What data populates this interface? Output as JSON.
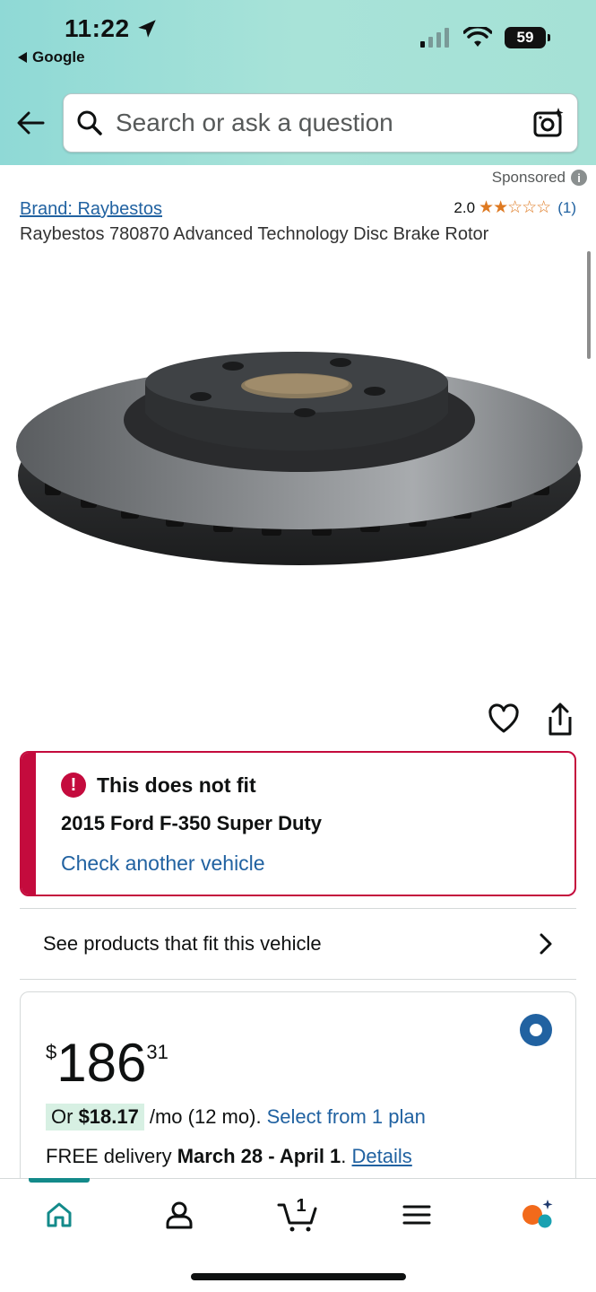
{
  "status": {
    "time": "11:22",
    "back_app": "Google",
    "battery": "59"
  },
  "search": {
    "placeholder": "Search or ask a question"
  },
  "product": {
    "sponsored": "Sponsored",
    "brand": "Brand: Raybestos",
    "rating_value": "2.0",
    "rating_stars": 2,
    "rating_count": "(1)",
    "title": "Raybestos 780870 Advanced Technology Disc Brake Rotor"
  },
  "fit": {
    "heading": "This does not fit",
    "vehicle": "2015 Ford F-350 Super Duty",
    "check_link": "Check another vehicle",
    "see_products": "See products that fit this vehicle"
  },
  "price": {
    "symbol": "$",
    "whole": "186",
    "fraction": "31",
    "monthly_prefix": "Or ",
    "monthly_amount": "$18.17",
    "monthly_suffix": "/mo (12 mo).",
    "plan_link": "Select from 1 plan",
    "delivery_prefix": "FREE delivery ",
    "delivery_dates": "March 28 - April 1",
    "delivery_suffix": ". ",
    "details_link": "Details"
  },
  "nav": {
    "items": [
      "home-icon",
      "account-icon",
      "cart-icon",
      "menu-icon",
      "rufus-icon"
    ],
    "cart_count": "1"
  },
  "colors": {
    "accent_blue": "#2162a1",
    "alert_red": "#c40b3d",
    "star_orange": "#de7921",
    "teal": "#138a8a"
  }
}
